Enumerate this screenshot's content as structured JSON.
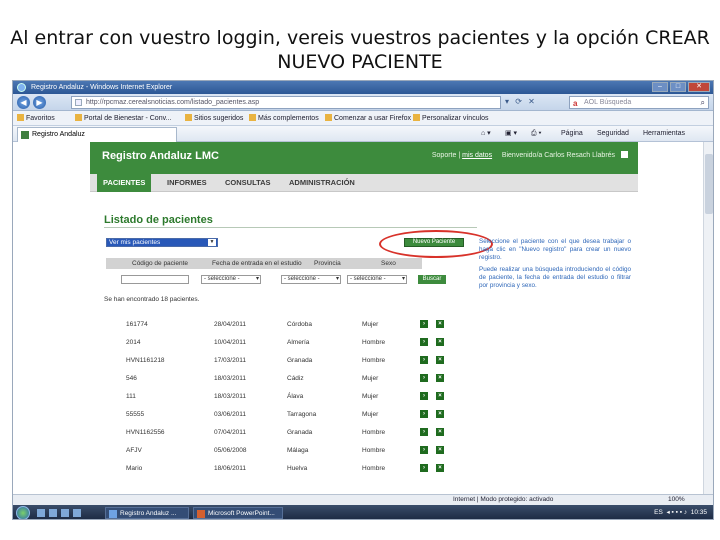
{
  "slide": {
    "title_line1": "Al entrar con vuestro loggin, vereis vuestros pacientes y la opción CREAR",
    "title_line2": "NUEVO PACIENTE"
  },
  "browser": {
    "window_title": "Registro Andaluz - Windows Internet Explorer",
    "url": "http://rpcmaz.cerealsnoticias.com/listado_pacientes.asp",
    "search_placeholder": "AOL Búsqueda",
    "links": [
      "Favoritos",
      "Portal de Bienestar - Conv...",
      "Sitios sugeridos",
      "Más complementos",
      "Comenzar a usar Firefox",
      "Personalizar vínculos"
    ],
    "tab_label": "Registro Andaluz",
    "commands": [
      "Página",
      "Seguridad",
      "Herramientas"
    ],
    "status": "Internet | Modo protegido: activado",
    "zoom": "100%"
  },
  "app": {
    "header_title": "Registro Andaluz LMC",
    "support_label": "Soporte",
    "my_data_link": "mis datos",
    "welcome": "Bienvenido/a Carlos Resach Llabrés",
    "nav": [
      "PACIENTES",
      "INFORMES",
      "CONSULTAS",
      "ADMINISTRACIÓN"
    ],
    "list_title": "Listado de pacientes",
    "view_select": "Ver mis pacientes",
    "new_patient_button": "Nuevo Paciente",
    "filter_headers": [
      "Código de paciente",
      "Fecha de entrada en el estudio",
      "Provincia",
      "Sexo"
    ],
    "filter_select_default": "- seleccione -",
    "search_button": "Buscar",
    "found_text": "Se han encontrado 18 pacientes.",
    "patients": [
      {
        "code": "161774",
        "date": "28/04/2011",
        "province": "Córdoba",
        "sex": "Mujer"
      },
      {
        "code": "2014",
        "date": "10/04/2011",
        "province": "Almería",
        "sex": "Hombre"
      },
      {
        "code": "HVN1161218",
        "date": "17/03/2011",
        "province": "Granada",
        "sex": "Hombre"
      },
      {
        "code": "546",
        "date": "18/03/2011",
        "province": "Cádiz",
        "sex": "Mujer"
      },
      {
        "code": "111",
        "date": "18/03/2011",
        "province": "Álava",
        "sex": "Mujer"
      },
      {
        "code": "55555",
        "date": "03/06/2011",
        "province": "Tarragona",
        "sex": "Mujer"
      },
      {
        "code": "HVN1162556",
        "date": "07/04/2011",
        "province": "Granada",
        "sex": "Hombre"
      },
      {
        "code": "AFJV",
        "date": "05/06/2008",
        "province": "Málaga",
        "sex": "Hombre"
      },
      {
        "code": "Mario",
        "date": "18/06/2011",
        "province": "Huelva",
        "sex": "Hombre"
      }
    ],
    "help": [
      "Seleccione el paciente con el que desea trabajar o haga clic en \"Nuevo registro\" para crear un nuevo registro.",
      "Puede realizar una búsqueda introduciendo el código de paciente, la fecha de entrada del estudio o filtrar por provincia y sexo."
    ]
  },
  "taskbar": {
    "items": [
      "Registro Andaluz ...",
      "Microsoft PowerPoint..."
    ],
    "lang": "ES",
    "clock": "10:35"
  },
  "colors": {
    "brand_green": "#3d8b3d",
    "highlight_ring": "#d8322a",
    "help_text": "#2d66b8"
  }
}
